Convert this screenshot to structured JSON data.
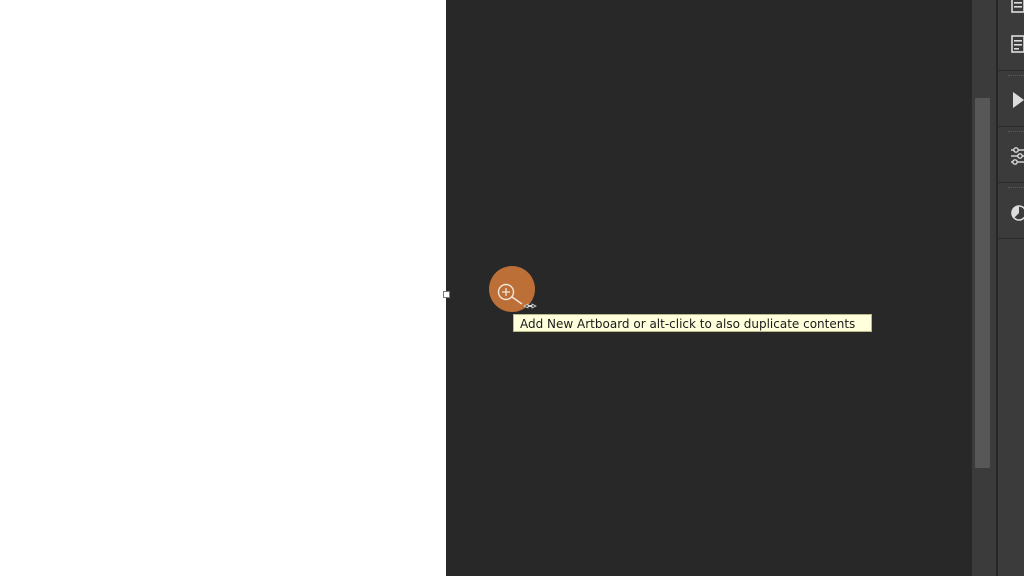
{
  "tooltip": {
    "text": "Add New Artboard or alt-click to also duplicate contents"
  },
  "cursor": {
    "icon": "add-artboard-cursor-icon",
    "highlight_color": "#d67d3a"
  },
  "right_panel": {
    "icons": [
      "layers-panel-icon",
      "properties-panel-icon",
      "play-actions-icon",
      "adjustments-sliders-icon",
      "color-wheel-icon"
    ]
  },
  "colors": {
    "artboard": "#ffffff",
    "pasteboard": "#282828",
    "panel": "#3b3b3b",
    "tooltip_bg": "#ffffdc"
  }
}
